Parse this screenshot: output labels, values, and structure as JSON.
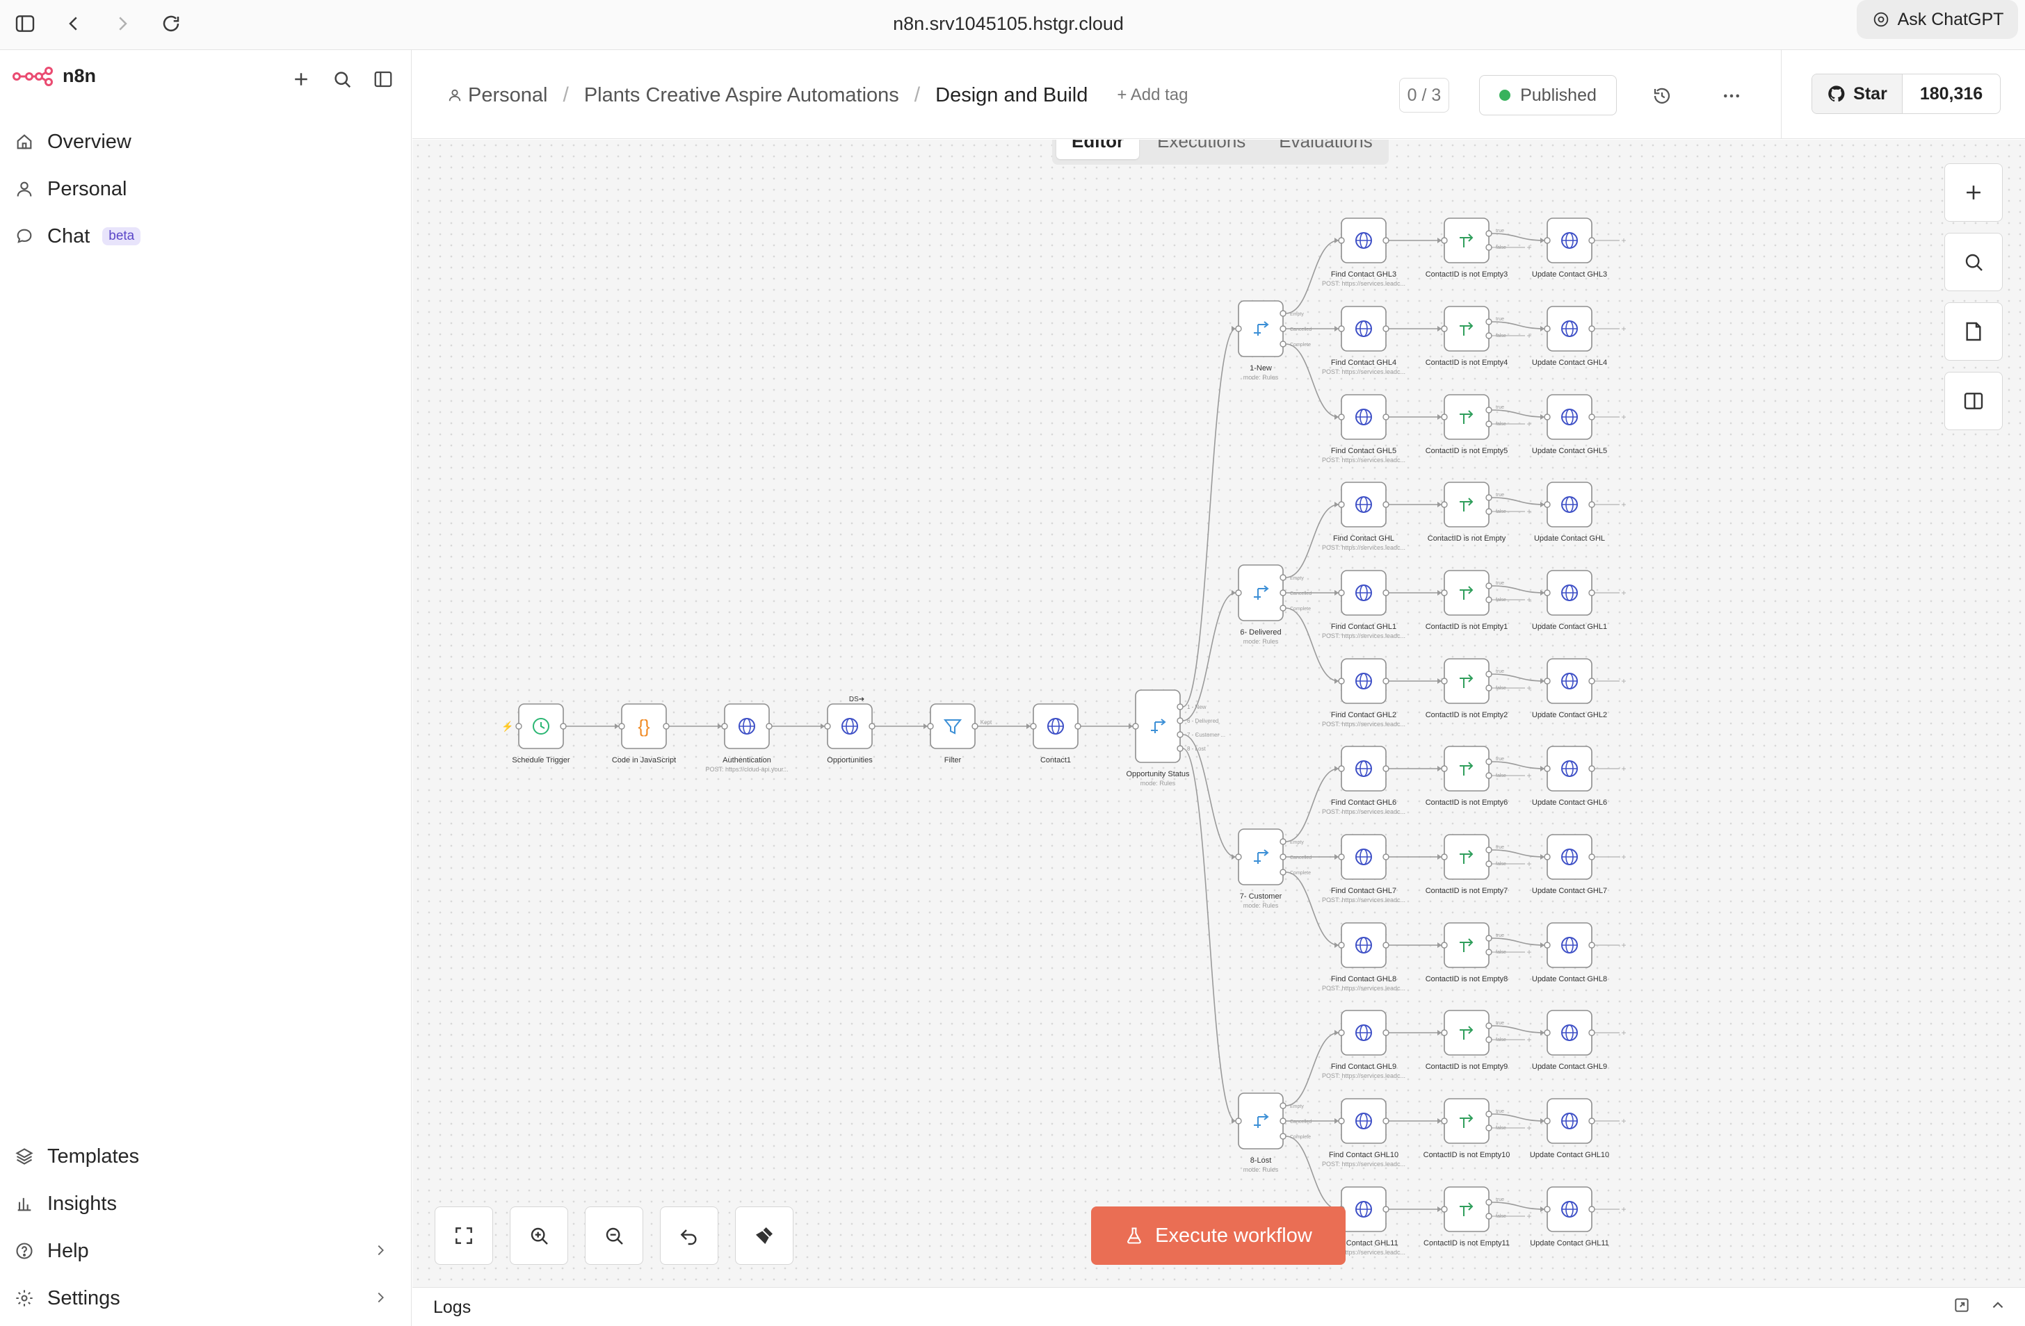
{
  "browser": {
    "url": "n8n.srv1045105.hstgr.cloud",
    "ask_chatgpt": "Ask ChatGPT"
  },
  "sidebar": {
    "brand": "n8n",
    "nav": [
      {
        "label": "Overview",
        "icon": "home-icon"
      },
      {
        "label": "Personal",
        "icon": "user-icon"
      },
      {
        "label": "Chat",
        "icon": "chat-icon",
        "badge": "beta"
      }
    ],
    "bottom": [
      {
        "label": "Templates",
        "icon": "templates-icon"
      },
      {
        "label": "Insights",
        "icon": "insights-icon"
      },
      {
        "label": "Help",
        "icon": "help-icon"
      },
      {
        "label": "Settings",
        "icon": "settings-icon"
      }
    ]
  },
  "header": {
    "breadcrumb": {
      "project": "Personal",
      "folder": "Plants Creative Aspire Automations",
      "workflow": "Design and Build"
    },
    "add_tag": "+ Add tag",
    "counter": "0 / 3",
    "status": "Published",
    "github_star": "Star",
    "github_count": "180,316"
  },
  "tabs": [
    "Editor",
    "Executions",
    "Evaluations"
  ],
  "canvas": {
    "execute_label": "Execute workflow",
    "main_nodes": [
      {
        "name": "Schedule Trigger",
        "icon": "clock-icon",
        "sub": ""
      },
      {
        "name": "Code in JavaScript",
        "icon": "code-icon",
        "sub": ""
      },
      {
        "name": "Authentication",
        "icon": "globe-icon",
        "sub": "POST: https://cloud-api.your..."
      },
      {
        "name": "Opportunities",
        "icon": "globe-icon",
        "sub": ""
      },
      {
        "name": "Filter",
        "icon": "filter-icon",
        "sub": ""
      },
      {
        "name": "Contact1",
        "icon": "globe-icon",
        "sub": ""
      },
      {
        "name": "Opportunity Status",
        "icon": "switch-icon",
        "sub": "mode: Rules"
      }
    ],
    "opportunity_outputs": [
      "1 - New",
      "6 - Delivered",
      "7 - Customer ...",
      "8 - Lost"
    ],
    "branch_outputs": [
      "Empty",
      "Cancelled",
      "Complete"
    ],
    "if_outputs": [
      "true",
      "false"
    ],
    "http_sub": "POST: https://services.leadc...",
    "switches": [
      {
        "name": "1-New",
        "sub": "mode: Rules",
        "rows": [
          {
            "find": "Find Contact GHL3",
            "check": "ContactID is not Empty3",
            "update": "Update Contact GHL3"
          },
          {
            "find": "Find Contact GHL4",
            "check": "ContactID is not Empty4",
            "update": "Update Contact GHL4"
          },
          {
            "find": "Find Contact GHL5",
            "check": "ContactID is not Empty5",
            "update": "Update Contact GHL5"
          }
        ]
      },
      {
        "name": "6- Delivered",
        "sub": "mode: Rules",
        "rows": [
          {
            "find": "Find Contact GHL",
            "check": "ContactID is not Empty",
            "update": "Update Contact GHL"
          },
          {
            "find": "Find Contact GHL1",
            "check": "ContactID is not Empty1",
            "update": "Update Contact GHL1"
          },
          {
            "find": "Find Contact GHL2",
            "check": "ContactID is not Empty2",
            "update": "Update Contact GHL2"
          }
        ]
      },
      {
        "name": "7- Customer",
        "sub": "mode: Rules",
        "rows": [
          {
            "find": "Find Contact GHL6",
            "check": "ContactID is not Empty6",
            "update": "Update Contact GHL6"
          },
          {
            "find": "Find Contact GHL7",
            "check": "ContactID is not Empty7",
            "update": "Update Contact GHL7"
          },
          {
            "find": "Find Contact GHL8",
            "check": "ContactID is not Empty8",
            "update": "Update Contact GHL8"
          }
        ]
      },
      {
        "name": "8-Lost",
        "sub": "mode: Rules",
        "rows": [
          {
            "find": "Find Contact GHL9",
            "check": "ContactID is not Empty9",
            "update": "Update Contact GHL9"
          },
          {
            "find": "Find Contact GHL10",
            "check": "ContactID is not Empty10",
            "update": "Update Contact GHL10"
          },
          {
            "find": "Find Contact GHL11",
            "check": "ContactID is not Empty11",
            "update": "Update Contact GHL11"
          }
        ]
      }
    ]
  },
  "logs": {
    "label": "Logs"
  },
  "colors": {
    "accent": "#ea6e54",
    "brand": "#ea4b71",
    "published": "#38b25c",
    "http": "#3d4fc6",
    "switch": "#3b8fd6",
    "if": "#2f9e5b",
    "code": "#f08a24",
    "trigger": "#2bb673"
  }
}
